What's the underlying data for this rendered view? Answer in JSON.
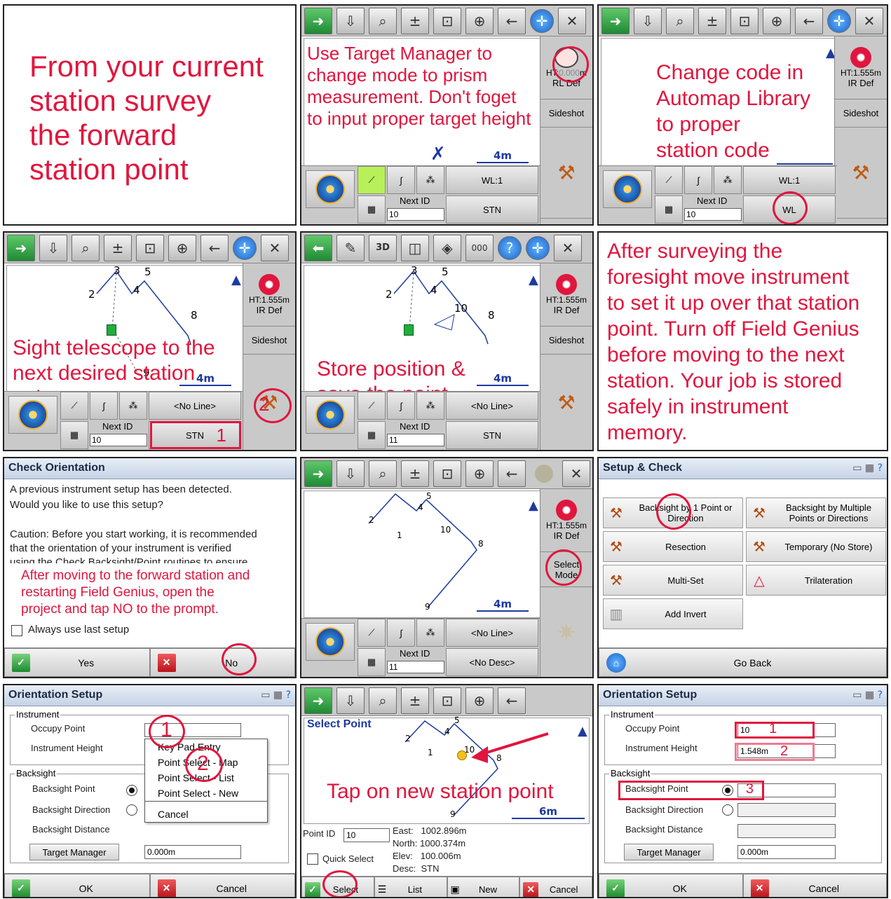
{
  "panel1": {
    "note": "From your current\nstation survey\nthe forward\nstation point"
  },
  "sidebar_common": {
    "ht": "HT:1.555m",
    "ir_def": "IR Def",
    "rl_def": "RL Def",
    "ht_partial": "HT:",
    "ht_partial_suffix": "m",
    "sideshot": "Sideshot",
    "select_mode": "Select\nMode"
  },
  "panel2": {
    "note": "Use Target Manager to\nchange mode to prism\nmeasurement. Don't foget\nto input proper target height",
    "scale": "4m",
    "wl": "WL:1",
    "next_id_label": "Next ID",
    "next_id": "10",
    "stn": "STN"
  },
  "panel3": {
    "note": "Change code in\nAutomap Library\nto proper\nstation code",
    "wl": "WL:1",
    "next_id_label": "Next ID",
    "next_id": "10",
    "code": "WL"
  },
  "panel4": {
    "note": "Sight telescope to the\nnext desired station\npoint",
    "scale": "4m",
    "line": "<No Line>",
    "next_id_label": "Next ID",
    "next_id": "10",
    "stn": "STN",
    "step1": "1",
    "step2": "2",
    "points": [
      "2",
      "3",
      "4",
      "5",
      "8",
      "9"
    ]
  },
  "panel5": {
    "note": "Store position &\nsave the point",
    "scale": "4m",
    "line": "<No Line>",
    "next_id_label": "Next ID",
    "next_id": "11",
    "stn": "STN",
    "points": [
      "2",
      "3",
      "4",
      "5",
      "8",
      "10"
    ]
  },
  "panel6": {
    "note": "After surveying the\nforesight move instrument\nto set it up over that station\npoint. Turn off Field Genius\nbefore moving to the next\nstation. Your job is stored\nsafely in instrument\nmemory."
  },
  "panel7": {
    "title": "Check Orientation",
    "line1": "A previous instrument setup has been detected.",
    "line2": "Would you like to use this setup?",
    "line3": "Caution: Before you start working, it is recommended",
    "line4": "that the orientation of your instrument is verified",
    "line5": "using the Check Backsight/Point routines to ensure",
    "note": "After moving to the forward station and\nrestarting Field Genius, open the\nproject and tap NO to the prompt.",
    "always": "Always use last setup",
    "yes": "Yes",
    "no": "No"
  },
  "panel8": {
    "scale": "4m",
    "line": "<No Line>",
    "desc": "<No Desc>",
    "next_id_label": "Next ID",
    "next_id": "11",
    "points": [
      "1",
      "2",
      "4",
      "5",
      "8",
      "9",
      "10"
    ]
  },
  "panel9": {
    "title": "Setup & Check",
    "cells": [
      "Backsight by 1 Point or\nDirection",
      "Backsight by Multiple\nPoints or Directions",
      "Resection",
      "Temporary (No Store)",
      "Multi-Set",
      "Trilateration",
      "Add Invert"
    ],
    "go_back": "Go Back"
  },
  "panel10": {
    "title": "Orientation Setup",
    "instrument": "Instrument",
    "occupy": "Occupy Point",
    "inst_height": "Instrument Height",
    "backsight": "Backsight",
    "bs_point": "Backsight Point",
    "bs_dir": "Backsight Direction",
    "bs_dist": "Backsight Distance",
    "target_mgr": "Target Manager",
    "dist_val": "0.000m",
    "menu": [
      "Key Pad Entry",
      "Point Select - Map",
      "Point Select - List",
      "Point Select - New",
      "Cancel"
    ],
    "step1": "1",
    "step2": "2",
    "ok": "OK",
    "cancel": "Cancel"
  },
  "panel11": {
    "title": "Select Point",
    "note": "Tap on new station point",
    "scale": "6m",
    "point_id_label": "Point ID",
    "point_id": "10",
    "east": "East:   1002.896m",
    "north": "North: 1000.374m",
    "elev": "Elev:   100.006m",
    "desc": "Desc:  STN",
    "quick": "Quick Select",
    "select": "Select",
    "list": "List",
    "new": "New",
    "cancel": "Cancel",
    "points": [
      "1",
      "2",
      "4",
      "5",
      "8",
      "9",
      "10"
    ]
  },
  "panel12": {
    "title": "Orientation Setup",
    "instrument": "Instrument",
    "occupy": "Occupy Point",
    "occupy_val": "10",
    "inst_height": "Instrument Height",
    "height_val": "1.548m",
    "backsight": "Backsight",
    "bs_point": "Backsight Point",
    "bs_dir": "Backsight Direction",
    "bs_dist": "Backsight Distance",
    "target_mgr": "Target Manager",
    "dist_val": "0.000m",
    "step1": "1",
    "step2": "2",
    "step3": "3",
    "ok": "OK",
    "cancel": "Cancel"
  }
}
